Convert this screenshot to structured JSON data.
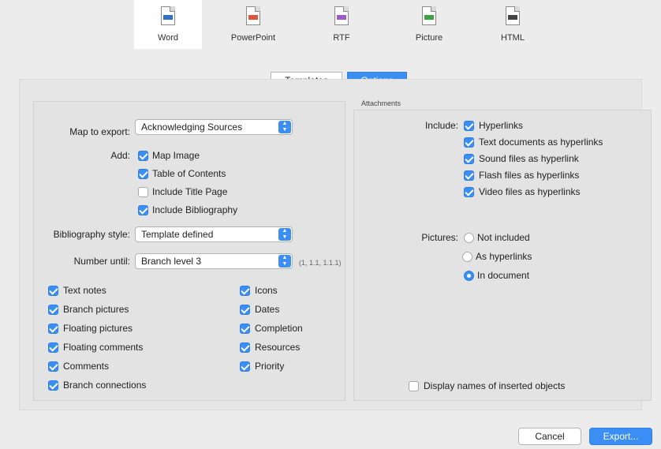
{
  "formats": [
    {
      "label": "Word",
      "selected": true,
      "icon": "word-doc-icon",
      "color": "#2f6fc6"
    },
    {
      "label": "PowerPoint",
      "selected": false,
      "icon": "powerpoint-doc-icon",
      "color": "#e0553a"
    },
    {
      "label": "RTF",
      "selected": false,
      "icon": "rtf-doc-icon",
      "color": "#9a5bcc"
    },
    {
      "label": "Picture",
      "selected": false,
      "icon": "picture-doc-icon",
      "color": "#3ea14a"
    },
    {
      "label": "HTML",
      "selected": false,
      "icon": "html-doc-icon",
      "color": "#444444"
    }
  ],
  "tabs": {
    "templates": "Templates",
    "options": "Options",
    "active": "Options"
  },
  "left": {
    "map_label": "Map to export:",
    "map_value": "Acknowledging Sources",
    "add_label": "Add:",
    "add_items": [
      {
        "label": "Map Image",
        "checked": true
      },
      {
        "label": "Table of Contents",
        "checked": true
      },
      {
        "label": "Include Title Page",
        "checked": false
      },
      {
        "label": "Include Bibliography",
        "checked": true
      }
    ],
    "bib_label": "Bibliography style:",
    "bib_value": "Template defined",
    "number_label": "Number until:",
    "number_value": "Branch level 3",
    "number_hint": "(1, 1.1, 1.1.1)",
    "col1": [
      {
        "label": "Text notes",
        "checked": true
      },
      {
        "label": "Branch pictures",
        "checked": true
      },
      {
        "label": "Floating pictures",
        "checked": true
      },
      {
        "label": "Floating comments",
        "checked": true
      },
      {
        "label": "Comments",
        "checked": true
      },
      {
        "label": "Branch connections",
        "checked": true
      }
    ],
    "col2": [
      {
        "label": "Icons",
        "checked": true
      },
      {
        "label": "Dates",
        "checked": true
      },
      {
        "label": "Completion",
        "checked": true
      },
      {
        "label": "Resources",
        "checked": true
      },
      {
        "label": "Priority",
        "checked": true
      }
    ]
  },
  "right": {
    "section_title": "Attachments",
    "include_label": "Include:",
    "include_items": [
      {
        "label": "Hyperlinks",
        "checked": true
      },
      {
        "label": "Text documents as hyperlinks",
        "checked": true
      },
      {
        "label": "Sound files as hyperlink",
        "checked": true
      },
      {
        "label": "Flash files as hyperlinks",
        "checked": true
      },
      {
        "label": "Video files as hyperlinks",
        "checked": true
      }
    ],
    "pictures_label": "Pictures:",
    "pictures_options": [
      {
        "label": "Not included",
        "selected": false
      },
      {
        "label": "As hyperlinks",
        "selected": false
      },
      {
        "label": "In document",
        "selected": true
      }
    ],
    "display_names": {
      "label": "Display names of inserted objects",
      "checked": false
    }
  },
  "buttons": {
    "cancel": "Cancel",
    "export": "Export..."
  },
  "accent": "#3b8ef3"
}
